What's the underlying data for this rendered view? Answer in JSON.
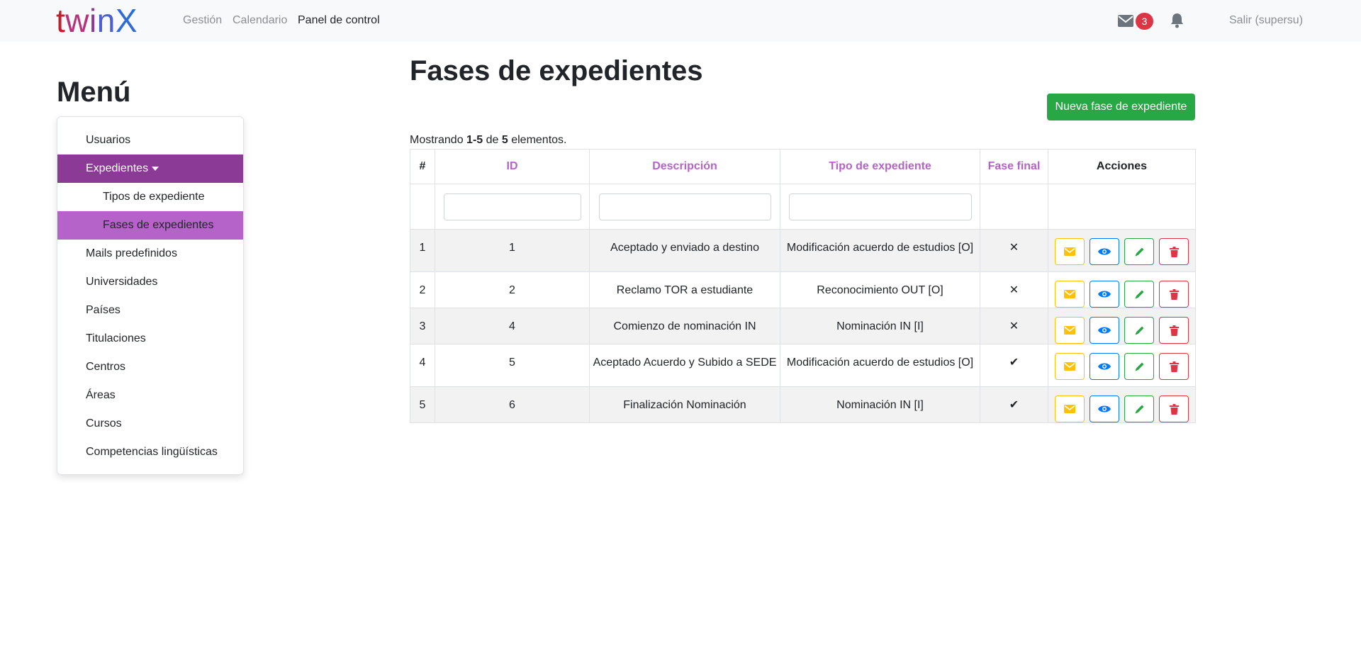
{
  "navbar": {
    "brand": "twinX",
    "links": [
      "Gestión",
      "Calendario",
      "Panel de control"
    ],
    "mail_count": "3",
    "logout": "Salir (supersu)"
  },
  "sidebar": {
    "title": "Menú",
    "items": [
      {
        "label": "Usuarios",
        "level": 0
      },
      {
        "label": "Expedientes",
        "level": 0
      },
      {
        "label": "Tipos de expediente",
        "level": 1
      },
      {
        "label": "Fases de expedientes",
        "level": 1
      },
      {
        "label": "Mails predefinidos",
        "level": 0
      },
      {
        "label": "Universidades",
        "level": 0
      },
      {
        "label": "Países",
        "level": 0
      },
      {
        "label": "Titulaciones",
        "level": 0
      },
      {
        "label": "Centros",
        "level": 0
      },
      {
        "label": "Áreas",
        "level": 0
      },
      {
        "label": "Cursos",
        "level": 0
      },
      {
        "label": "Competencias lingüísticas",
        "level": 0
      }
    ]
  },
  "main": {
    "title": "Fases de expedientes",
    "new_button": "Nueva fase de expediente",
    "summary": {
      "prefix": "Mostrando ",
      "range": "1-5",
      "mid": " de ",
      "total": "5",
      "suffix": " elementos."
    },
    "table": {
      "headers": [
        "#",
        "ID",
        "Descripción",
        "Tipo de expediente",
        "Fase final",
        "Acciones"
      ],
      "rows": [
        {
          "n": "1",
          "id": "1",
          "descripcion": "Aceptado y enviado a destino",
          "tipo": "Modificación acuerdo de estudios [O]",
          "final": "✕"
        },
        {
          "n": "2",
          "id": "2",
          "descripcion": "Reclamo TOR a estudiante",
          "tipo": "Reconocimiento OUT [O]",
          "final": "✕"
        },
        {
          "n": "3",
          "id": "4",
          "descripcion": "Comienzo de nominación IN",
          "tipo": "Nominación IN [I]",
          "final": "✕"
        },
        {
          "n": "4",
          "id": "5",
          "descripcion": "Aceptado Acuerdo y Subido a SEDE",
          "tipo": "Modificación acuerdo de estudios [O]",
          "final": "✔"
        },
        {
          "n": "5",
          "id": "6",
          "descripcion": "Finalización Nominación",
          "tipo": "Nominación IN [I]",
          "final": "✔"
        }
      ]
    }
  },
  "colors": {
    "primary_purple": "#8b3a96",
    "light_purple": "#b562c9",
    "success": "#28a745",
    "warning": "#ffc107",
    "info": "#007bff",
    "danger": "#dc3545"
  },
  "icons": [
    "envelope-icon",
    "bell-icon",
    "eye-icon",
    "pencil-icon",
    "trash-icon",
    "cross-icon",
    "check-icon"
  ]
}
